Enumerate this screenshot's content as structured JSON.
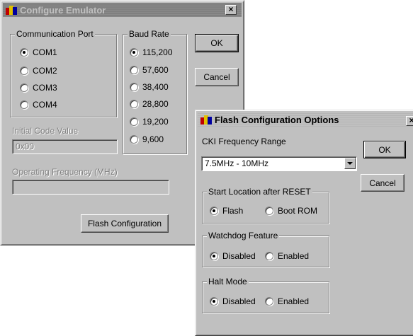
{
  "emulator_dialog": {
    "title": "Configure Emulator",
    "close_glyph": "×",
    "comm_port": {
      "label": "Communication Port",
      "options": [
        "COM1",
        "COM2",
        "COM3",
        "COM4"
      ],
      "selected": "COM1"
    },
    "baud_rate": {
      "label": "Baud Rate",
      "options": [
        "115,200",
        "57,600",
        "38,400",
        "28,800",
        "19,200",
        "9,600"
      ],
      "selected": "115,200"
    },
    "ok_label": "OK",
    "cancel_label": "Cancel",
    "initial_code_value": {
      "label": "Initial Code Value",
      "value": "0x00"
    },
    "operating_frequency": {
      "label": "Operating Frequency (MHz)",
      "value": ""
    },
    "flash_config_label": "Flash Configuration"
  },
  "flash_dialog": {
    "title": "Flash Configuration Options",
    "close_glyph": "×",
    "cki_frequency": {
      "label": "CKI Frequency Range",
      "value": "7.5MHz - 10MHz"
    },
    "ok_label": "OK",
    "cancel_label": "Cancel",
    "start_location": {
      "label": "Start Location after RESET",
      "options": [
        "Flash",
        "Boot ROM"
      ],
      "selected": "Flash"
    },
    "watchdog": {
      "label": "Watchdog Feature",
      "options": [
        "Disabled",
        "Enabled"
      ],
      "selected": "Disabled"
    },
    "halt_mode": {
      "label": "Halt Mode",
      "options": [
        "Disabled",
        "Enabled"
      ],
      "selected": "Disabled"
    }
  },
  "colors": {
    "face": "#c0c0c0",
    "inactive_title": "#808080",
    "disabled_text": "#808080"
  }
}
